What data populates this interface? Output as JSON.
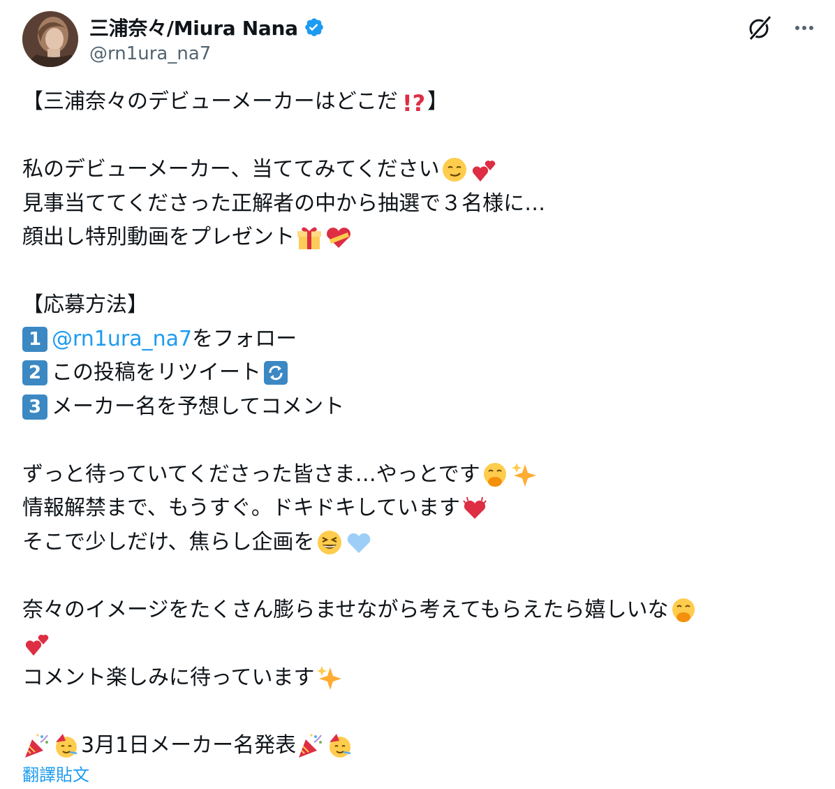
{
  "author": {
    "display_name": "三浦奈々/Miura Nana",
    "handle": "@rn1ura_na7",
    "verified": true,
    "avatar_icon": "avatar-photo"
  },
  "actions": {
    "grok_icon": "grok-icon",
    "more_icon": "more-icon"
  },
  "tweet": {
    "title": "【三浦奈々のデビューメーカーはどこだ",
    "title_close": "】",
    "l1": "私のデビューメーカー、当ててみてください",
    "l2": "見事当ててくださった正解者の中から抽選で３名様に…",
    "l3": "顔出し特別動画をプレゼント",
    "how_title": "【応募方法】",
    "step1_num": "1",
    "step1_link": "@rn1ura_na7",
    "step1_text": " をフォロー",
    "step2_num": "2",
    "step2_text": "この投稿をリツイート",
    "step3_num": "3",
    "step3_text": "メーカー名を予想してコメント",
    "l4": "ずっと待っていてくださった皆さま…やっとです",
    "l5": "情報解禁まで、もうすぐ。ドキドキしています",
    "l6": "そこで少しだけ、焦らし企画を",
    "l7": "奈々のイメージをたくさん膨らませながら考えてもらえたら嬉しいな",
    "l8": "コメント楽しみに待っています",
    "l9": "3月1日メーカー名発表"
  },
  "translate_label": "翻譯貼文",
  "colors": {
    "link": "#1d9bf0",
    "text": "#0f1419",
    "secondary": "#536471",
    "verified": "#1d9bf0",
    "keycap": "#3b88c3"
  }
}
